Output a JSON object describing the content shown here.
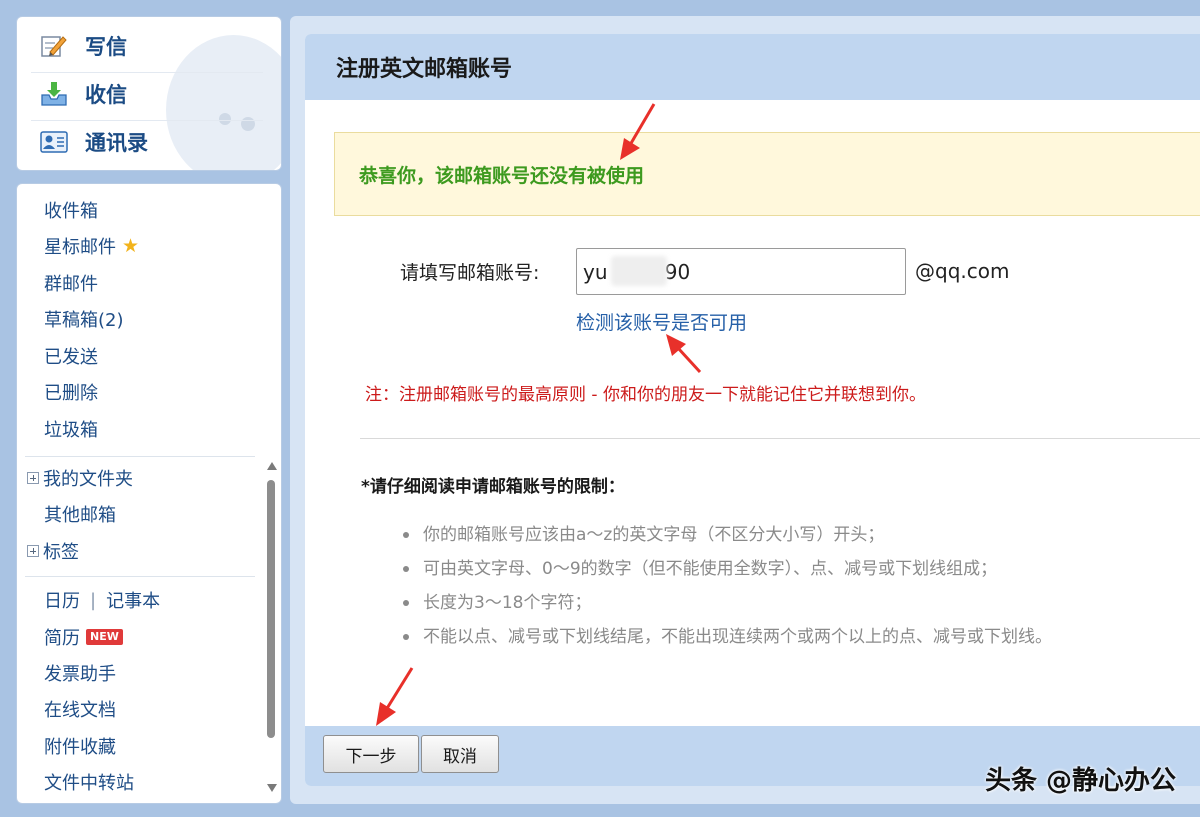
{
  "quick_actions": [
    {
      "label": "写信",
      "icon": "pencil-icon"
    },
    {
      "label": "收信",
      "icon": "inbox-download-icon"
    },
    {
      "label": "通讯录",
      "icon": "contacts-card-icon"
    }
  ],
  "folders": {
    "inbox": "收件箱",
    "starred": "星标邮件",
    "group": "群邮件",
    "drafts": "草稿箱(2)",
    "sent": "已发送",
    "deleted": "已删除",
    "spam": "垃圾箱",
    "my_folders": "我的文件夹",
    "other_mailbox": "其他邮箱",
    "tags": "标签",
    "calendar": "日历",
    "separator": "|",
    "notepad": "记事本",
    "resume": "简历",
    "new_badge": "NEW",
    "invoice": "发票助手",
    "online_docs": "在线文档",
    "attachments": "附件收藏",
    "file_transfer": "文件中转站"
  },
  "main": {
    "title": "注册英文邮箱账号",
    "success_message": "恭喜你，该邮箱账号还没有被使用",
    "field_label": "请填写邮箱账号:",
    "account_value": "yu       190",
    "domain_suffix": "@qq.com",
    "check_link": "检测该账号是否可用",
    "note": "注：注册邮箱账号的最高原则 - 你和你的朋友一下就能记住它并联想到你。",
    "rules_title": "*请仔细阅读申请邮箱账号的限制：",
    "rules": [
      "你的邮箱账号应该由a～z的英文字母（不区分大小写）开头；",
      "可由英文字母、0～9的数字（但不能使用全数字）、点、减号或下划线组成；",
      "长度为3～18个字符；",
      "不能以点、减号或下划线结尾，不能出现连续两个或两个以上的点、减号或下划线。"
    ],
    "next_button": "下一步",
    "cancel_button": "取消"
  },
  "watermark": "头条 @静心办公",
  "colors": {
    "background": "#a9c3e3",
    "header_bar": "#c0d6f0",
    "success_text": "#3d9a1f",
    "note_text": "#cc1b1b",
    "link": "#2660a8",
    "arrow": "#e8302a"
  }
}
